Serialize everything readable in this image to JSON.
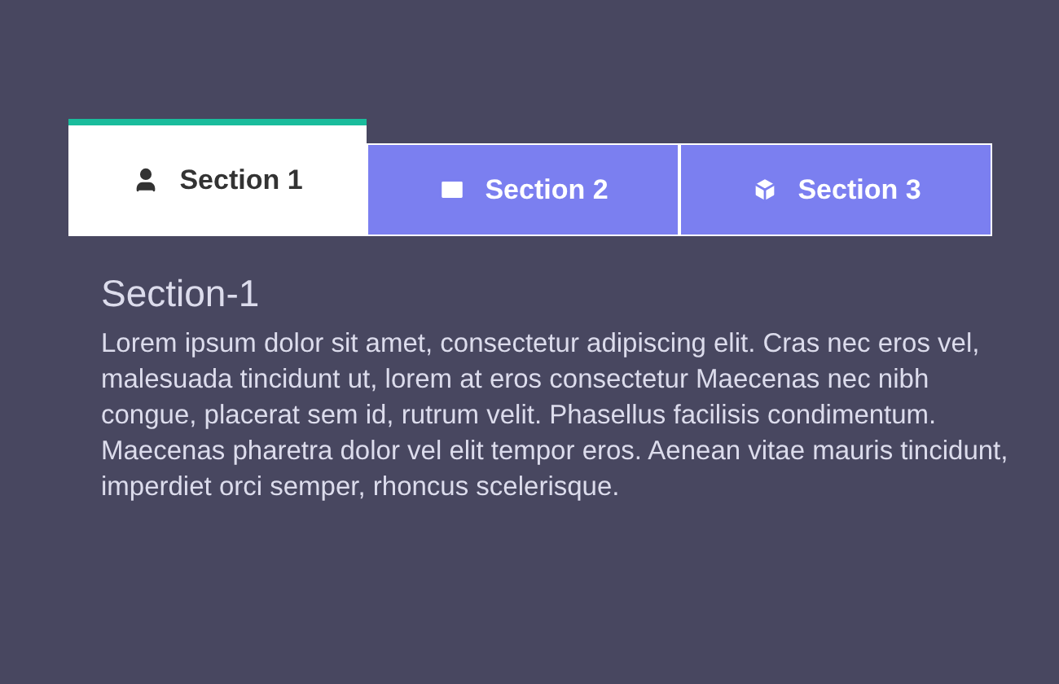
{
  "tabs": [
    {
      "label": "Section 1",
      "selected": true
    },
    {
      "label": "Section 2",
      "selected": false
    },
    {
      "label": "Section 3",
      "selected": false
    }
  ],
  "panel": {
    "heading": "Section-1",
    "body": "Lorem ipsum dolor sit amet, consectetur adipiscing elit. Cras nec eros vel, malesuada tincidunt ut, lorem at eros consectetur Maecenas nec nibh congue, placerat sem id, rutrum velit. Phasellus facilisis condimentum. Maecenas pharetra dolor vel elit tempor eros. Aenean vitae mauris tincidunt, imperdiet orci semper, rhoncus scelerisque."
  }
}
